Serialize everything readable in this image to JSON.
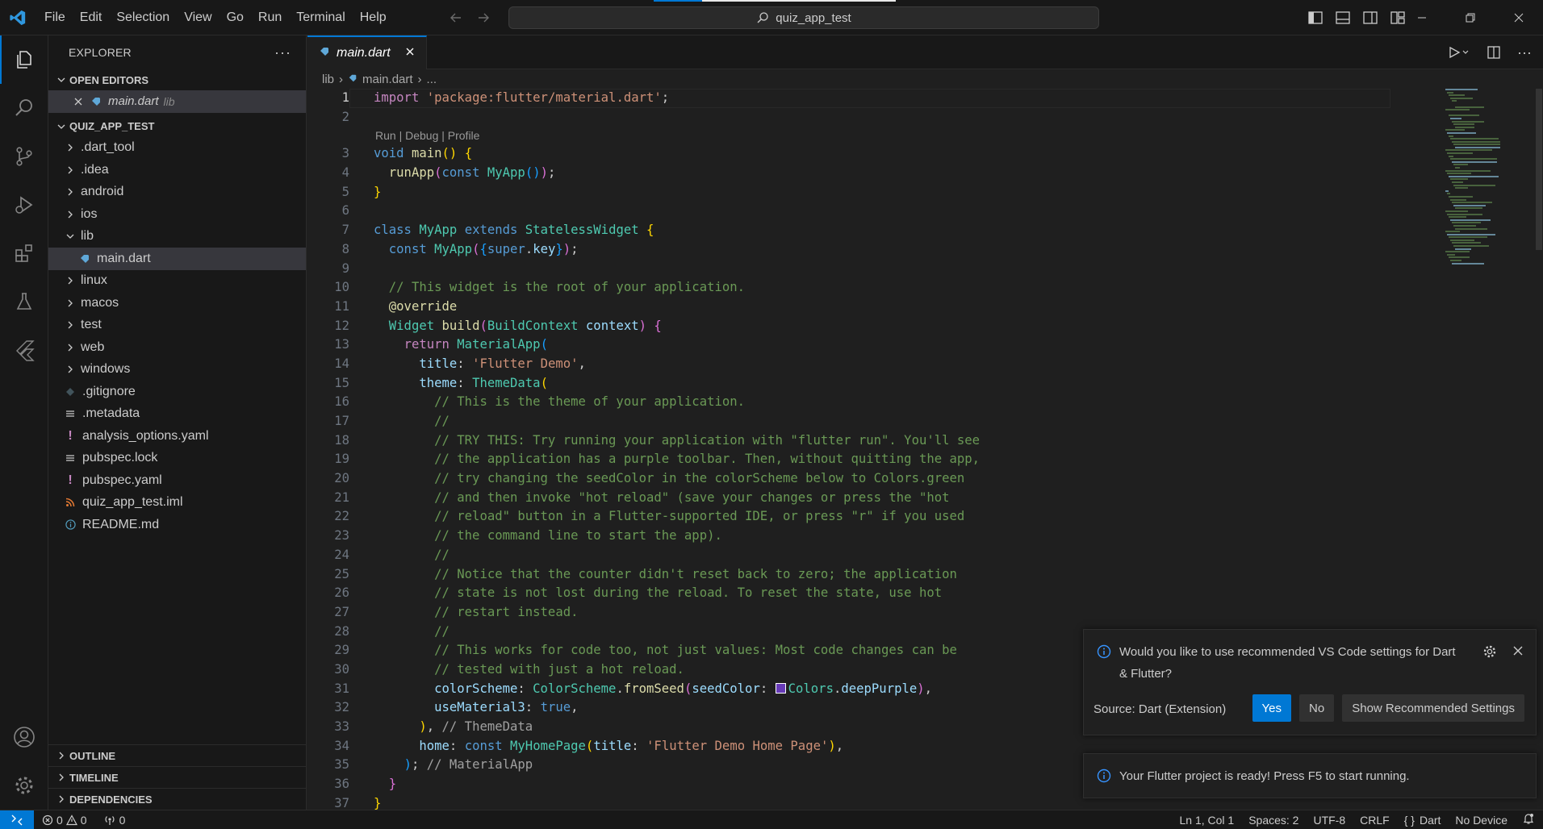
{
  "menu": [
    "File",
    "Edit",
    "Selection",
    "View",
    "Go",
    "Run",
    "Terminal",
    "Help"
  ],
  "search": {
    "text": "quiz_app_test"
  },
  "sidebar": {
    "title": "EXPLORER",
    "open_editors": {
      "header": "OPEN EDITORS",
      "items": [
        {
          "name": "main.dart",
          "path": "lib"
        }
      ]
    },
    "project": {
      "header": "QUIZ_APP_TEST",
      "items": [
        {
          "label": ".dart_tool",
          "kind": "folder"
        },
        {
          "label": ".idea",
          "kind": "folder"
        },
        {
          "label": "android",
          "kind": "folder"
        },
        {
          "label": "ios",
          "kind": "folder"
        },
        {
          "label": "lib",
          "kind": "folder-open"
        },
        {
          "label": "main.dart",
          "kind": "dart"
        },
        {
          "label": "linux",
          "kind": "folder"
        },
        {
          "label": "macos",
          "kind": "folder"
        },
        {
          "label": "test",
          "kind": "folder"
        },
        {
          "label": "web",
          "kind": "folder"
        },
        {
          "label": "windows",
          "kind": "folder"
        },
        {
          "label": ".gitignore",
          "kind": "git"
        },
        {
          "label": ".metadata",
          "kind": "lines"
        },
        {
          "label": "analysis_options.yaml",
          "kind": "yaml"
        },
        {
          "label": "pubspec.lock",
          "kind": "lines"
        },
        {
          "label": "pubspec.yaml",
          "kind": "yaml"
        },
        {
          "label": "quiz_app_test.iml",
          "kind": "rss"
        },
        {
          "label": "README.md",
          "kind": "info"
        }
      ]
    },
    "bottom_sections": [
      "OUTLINE",
      "TIMELINE",
      "DEPENDENCIES"
    ]
  },
  "editor": {
    "tab": "main.dart",
    "breadcrumb": [
      "lib",
      "main.dart",
      "..."
    ],
    "codelens": "Run | Debug | Profile",
    "line_numbers": [
      "1",
      "2",
      "3",
      "4",
      "5",
      "6",
      "7",
      "8",
      "9",
      "10",
      "11",
      "12",
      "13",
      "14",
      "15",
      "16",
      "17",
      "18",
      "19",
      "20",
      "21",
      "22",
      "23",
      "24",
      "25",
      "26",
      "27",
      "28",
      "29",
      "30",
      "31",
      "32",
      "33",
      "34",
      "35",
      "36",
      "37"
    ]
  },
  "notifications": {
    "settings": {
      "message": "Would you like to use recommended VS Code settings for Dart & Flutter?",
      "source": "Source: Dart (Extension)",
      "buttons": {
        "yes": "Yes",
        "no": "No",
        "show": "Show Recommended Settings"
      }
    },
    "ready": {
      "message": "Your Flutter project is ready! Press F5 to start running."
    }
  },
  "statusbar": {
    "errors": "0",
    "warnings": "0",
    "ports": "0",
    "position": "Ln 1, Col 1",
    "spaces": "Spaces: 2",
    "encoding": "UTF-8",
    "eol": "CRLF",
    "language": "Dart",
    "device": "No Device"
  },
  "colors": {
    "accent": "#0078d4",
    "seed_color_swatch": "#673ab7"
  }
}
